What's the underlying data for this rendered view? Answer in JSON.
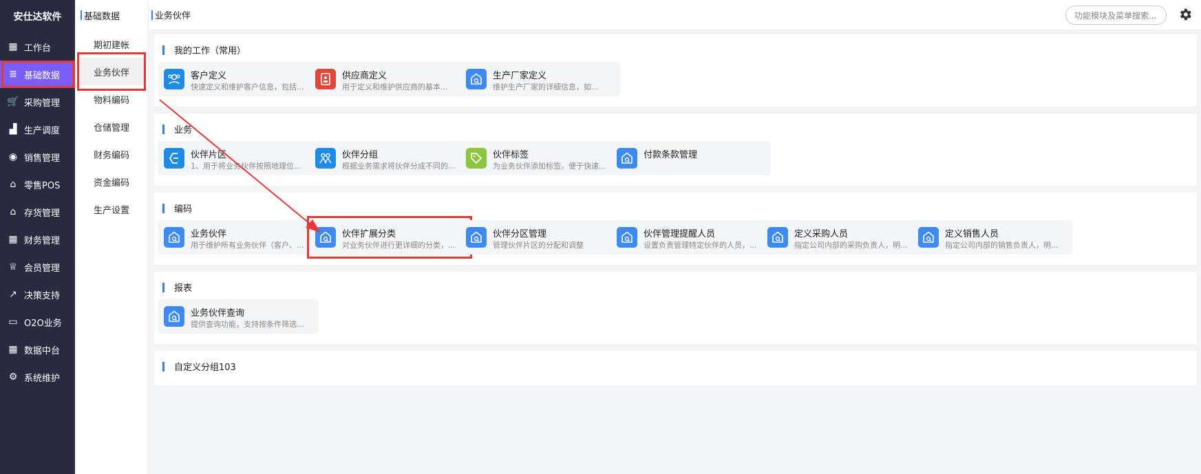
{
  "app": {
    "brand": "安仕达软件"
  },
  "sidebar": {
    "items": [
      {
        "label": "工作台",
        "icon": "grid-icon",
        "glyph": "▦"
      },
      {
        "label": "基础数据",
        "icon": "database-icon",
        "glyph": "≣",
        "active": true
      },
      {
        "label": "采购管理",
        "icon": "cart-icon",
        "glyph": "🛒"
      },
      {
        "label": "生产调度",
        "icon": "factory-icon",
        "glyph": "▟"
      },
      {
        "label": "销售管理",
        "icon": "sales-icon",
        "glyph": "◉"
      },
      {
        "label": "零售POS",
        "icon": "store-icon",
        "glyph": "⌂"
      },
      {
        "label": "存货管理",
        "icon": "warehouse-icon",
        "glyph": "⌂"
      },
      {
        "label": "财务管理",
        "icon": "grid-icon",
        "glyph": "▦"
      },
      {
        "label": "会员管理",
        "icon": "crown-icon",
        "glyph": "♕"
      },
      {
        "label": "决策支持",
        "icon": "chart-icon",
        "glyph": "↗"
      },
      {
        "label": "O2O业务",
        "icon": "monitor-icon",
        "glyph": "▭"
      },
      {
        "label": "数据中台",
        "icon": "grid-icon",
        "glyph": "▦"
      },
      {
        "label": "系统维护",
        "icon": "gear-icon",
        "glyph": "⚙"
      }
    ]
  },
  "subnav": {
    "header": "基础数据",
    "items": [
      {
        "label": "期初建帐"
      },
      {
        "label": "业务伙伴",
        "active": true
      },
      {
        "label": "物料编码"
      },
      {
        "label": "仓储管理"
      },
      {
        "label": "财务编码"
      },
      {
        "label": "资金编码"
      },
      {
        "label": "生产设置"
      }
    ]
  },
  "topbar": {
    "breadcrumb": "业务伙伴",
    "search_placeholder": "功能模块及菜单搜索..."
  },
  "sections": [
    {
      "title": "我的工作（常用）",
      "cards": [
        {
          "title": "客户定义",
          "desc": "快速定义和维护客户信息，包括...",
          "icon": "customer-icon",
          "color": "#1e8ce6"
        },
        {
          "title": "供应商定义",
          "desc": "用于定义和维护供应商的基本...",
          "icon": "supplier-icon",
          "color": "#e0473a"
        },
        {
          "title": "生产厂家定义",
          "desc": "维护生产厂家的详细信息，如...",
          "icon": "home-icon",
          "color": "#3d8af2"
        }
      ]
    },
    {
      "title": "业务",
      "cards": [
        {
          "title": "伙伴片区",
          "desc": "1、用于将业务伙伴按照地理位...",
          "icon": "region-icon",
          "color": "#1e8ce6"
        },
        {
          "title": "伙伴分组",
          "desc": "根据业务需求将伙伴分成不同的...",
          "icon": "group-icon",
          "color": "#1e8ce6"
        },
        {
          "title": "伙伴标签",
          "desc": "为业务伙伴添加标签，便于快速...",
          "icon": "tag-icon",
          "color": "#8cc63f"
        },
        {
          "title": "付款条款管理",
          "desc": "",
          "icon": "home-icon",
          "color": "#3d8af2"
        }
      ]
    },
    {
      "title": "编码",
      "cards": [
        {
          "title": "业务伙伴",
          "desc": "用于维护所有业务伙伴（客户、...",
          "icon": "home-icon",
          "color": "#3d8af2"
        },
        {
          "title": "伙伴扩展分类",
          "desc": "对业务伙伴进行更详细的分类，...",
          "icon": "home-icon",
          "color": "#3d8af2",
          "highlight": true
        },
        {
          "title": "伙伴分区管理",
          "desc": "管理伙伴片区的分配和调整",
          "icon": "home-icon",
          "color": "#3d8af2"
        },
        {
          "title": "伙伴管理提醒人员",
          "desc": "设置负责管理特定伙伴的人员，...",
          "icon": "home-icon",
          "color": "#3d8af2"
        },
        {
          "title": "定义采购人员",
          "desc": "指定公司内部的采购负责人，明...",
          "icon": "home-icon",
          "color": "#3d8af2"
        },
        {
          "title": "定义销售人员",
          "desc": "指定公司内部的销售负责人，明...",
          "icon": "home-icon",
          "color": "#3d8af2"
        }
      ]
    },
    {
      "title": "报表",
      "cards": [
        {
          "title": "业务伙伴查询",
          "desc": "提供查询功能，支持按条件筛选...",
          "icon": "home-icon",
          "color": "#3d8af2"
        }
      ]
    },
    {
      "title": "自定义分组103",
      "cards": []
    }
  ],
  "colors": {
    "sidebar_bg": "#262b3f",
    "active_purple": "#7b5cf5",
    "highlight_red": "#e53935",
    "accent_blue": "#3d7dea"
  }
}
